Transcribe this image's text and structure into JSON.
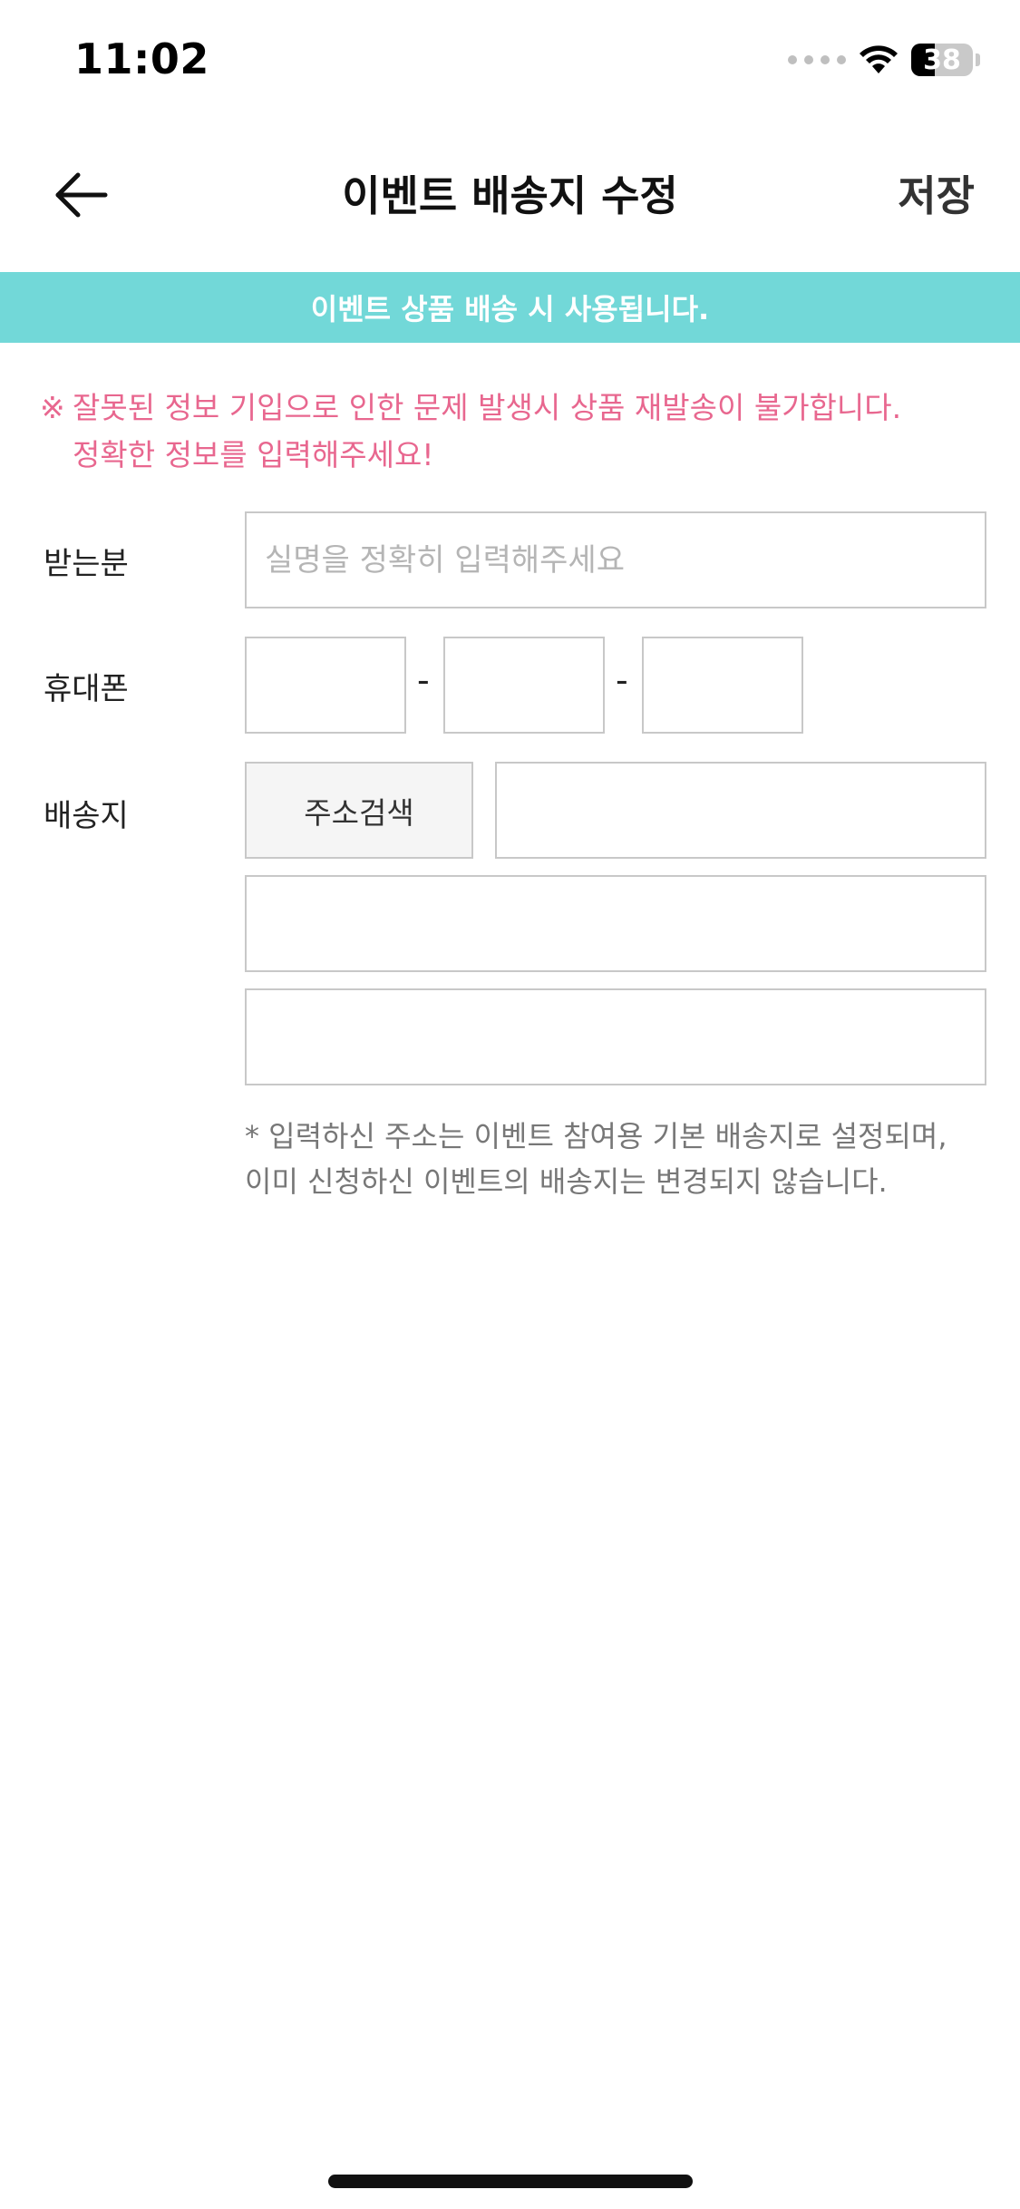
{
  "status_bar": {
    "time": "11:02",
    "battery_level": "38",
    "battery_fraction": 0.38
  },
  "header": {
    "back_icon": "arrow-left-icon",
    "title": "이벤트 배송지 수정",
    "save_label": "저장"
  },
  "banner": {
    "text": "이벤트 상품 배송 시 사용됩니다."
  },
  "warning": {
    "mark": "※",
    "line1": "잘못된 정보 기입으로 인한 문제 발생시 상품 재발송이 불가합니다.",
    "line2": "정확한 정보를 입력해주세요!"
  },
  "form": {
    "recipient": {
      "label": "받는분",
      "placeholder": "실명을 정확히 입력해주세요",
      "value": ""
    },
    "phone": {
      "label": "휴대폰",
      "part1": "",
      "part2": "",
      "part3": "",
      "separator": "-"
    },
    "address": {
      "label": "배송지",
      "search_button_label": "주소검색",
      "zipcode": "",
      "address1": "",
      "address2": "",
      "note_line1": "* 입력하신 주소는 이벤트 참여용 기본 배송지로 설정되며,",
      "note_line2": "이미 신청하신 이벤트의 배송지는 변경되지 않습니다."
    }
  },
  "colors": {
    "banner_bg": "#72d8d8",
    "warning_text": "#e8678f",
    "note_text": "#777777",
    "field_border": "#c8c8c8"
  }
}
